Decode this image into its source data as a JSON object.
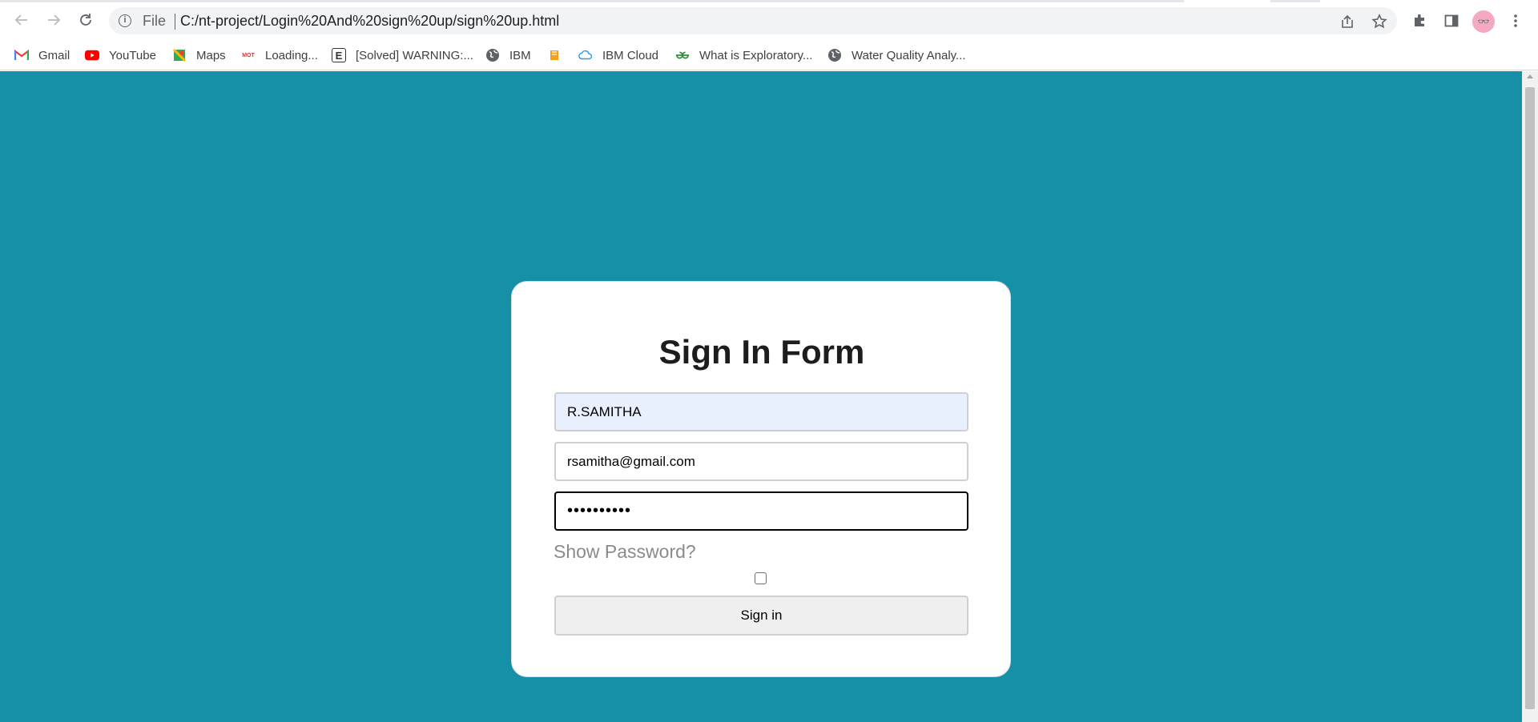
{
  "browser": {
    "scheme": "File",
    "url": "C:/nt-project/Login%20And%20sign%20up/sign%20up.html",
    "bookmarks": [
      {
        "label": "Gmail",
        "icon": "gmail-icon"
      },
      {
        "label": "YouTube",
        "icon": "youtube-icon"
      },
      {
        "label": "Maps",
        "icon": "maps-icon"
      },
      {
        "label": "Loading...",
        "icon": "site-icon"
      },
      {
        "label": "[Solved] WARNING:...",
        "icon": "e-icon"
      },
      {
        "label": "IBM",
        "icon": "globe-icon"
      },
      {
        "label": "",
        "icon": "book-icon"
      },
      {
        "label": "IBM Cloud",
        "icon": "cloud-icon"
      },
      {
        "label": "What is Exploratory...",
        "icon": "gfg-icon"
      },
      {
        "label": "Water Quality Analy...",
        "icon": "globe-icon"
      }
    ]
  },
  "form": {
    "title": "Sign In Form",
    "username_value": "R.SAMITHA",
    "email_value": "rsamitha@gmail.com",
    "password_value": "••••••••••",
    "show_password_label": "Show Password?",
    "show_password_checked": false,
    "submit_label": "Sign in"
  },
  "colors": {
    "page_background": "#1690a7",
    "card_background": "#ffffff",
    "autofill_background": "#e8f0fe"
  }
}
